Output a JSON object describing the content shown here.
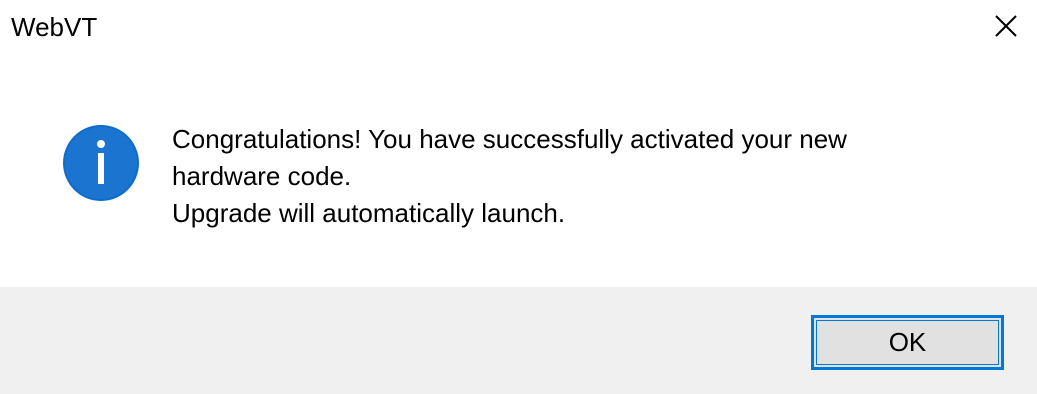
{
  "window": {
    "title": "WebVT",
    "close_icon": "close-icon"
  },
  "message": {
    "icon": "info-icon",
    "line1": "Congratulations! You have successfully activated your new",
    "line2": "hardware code.",
    "line3": "Upgrade will automatically launch."
  },
  "buttons": {
    "ok_label": "OK"
  },
  "colors": {
    "accent": "#0078d7",
    "footer_bg": "#f0f0f0",
    "button_bg": "#e1e1e1"
  }
}
